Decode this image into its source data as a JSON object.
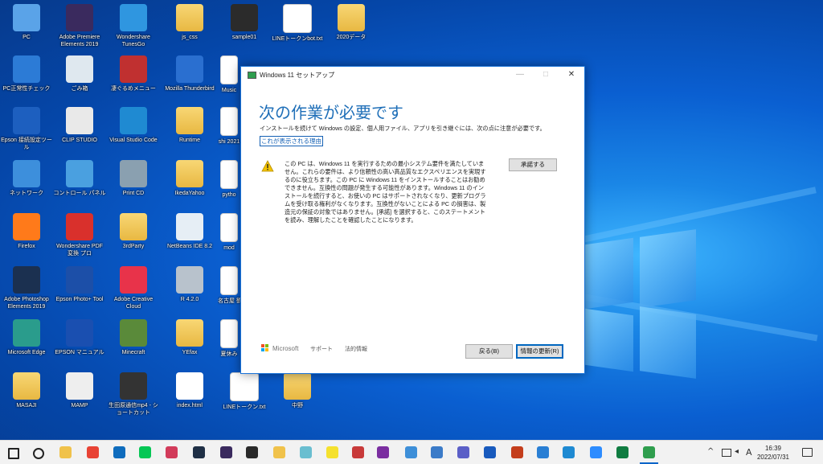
{
  "desktop": {
    "icons": [
      {
        "label": "PC",
        "icon": "pc-icon",
        "color": "#5aa3e8",
        "kind": "app"
      },
      {
        "label": "Adobe Premiere Elements 2019",
        "icon": "premiere-elements-icon",
        "color": "#3a2a5e",
        "kind": "app"
      },
      {
        "label": "Wondershare TunesGo",
        "icon": "tunesgo-icon",
        "color": "#2f96e0",
        "kind": "app"
      },
      {
        "label": "js_css",
        "icon": "folder-icon",
        "kind": "folder"
      },
      {
        "label": "sample01",
        "icon": "chrome-shortcut-icon",
        "color": "#2b2b2b",
        "kind": "app"
      },
      {
        "label": "LINEトークンbot.txt",
        "icon": "text-file-icon",
        "kind": "file"
      },
      {
        "label": "2020データ",
        "icon": "folder-icon",
        "kind": "folder"
      },
      {
        "label": "PC正常性チェック",
        "icon": "pc-health-check-icon",
        "color": "#2c7bd6",
        "kind": "app"
      },
      {
        "label": "ごみ箱",
        "icon": "recycle-bin-icon",
        "color": "#dfe8ef",
        "kind": "app"
      },
      {
        "label": "凄ぐるめメニュー",
        "icon": "menu-app-icon",
        "color": "#c03030",
        "kind": "app"
      },
      {
        "label": "Mozilla Thunderbird",
        "icon": "thunderbird-icon",
        "color": "#2a6fd0",
        "kind": "app"
      },
      {
        "label": "Epson 接続設定ツール",
        "icon": "epson-connect-icon",
        "color": "#1d5fbf",
        "kind": "app"
      },
      {
        "label": "CLIP STUDIO",
        "icon": "clip-studio-icon",
        "color": "#e9e9e9",
        "kind": "app"
      },
      {
        "label": "Visual Studio Code",
        "icon": "vscode-icon",
        "color": "#1f8ad2",
        "kind": "app"
      },
      {
        "label": "Runtime",
        "icon": "folder-icon",
        "kind": "folder"
      },
      {
        "label": "ネットワーク",
        "icon": "network-icon",
        "color": "#3d8fdc",
        "kind": "app"
      },
      {
        "label": "コントロール パネル",
        "icon": "control-panel-icon",
        "color": "#4aa0e0",
        "kind": "app"
      },
      {
        "label": "Print CD",
        "icon": "print-cd-icon",
        "color": "#8aa0b0",
        "kind": "app"
      },
      {
        "label": "IkedaYahoo",
        "icon": "folder-icon",
        "kind": "folder"
      },
      {
        "label": "Firefox",
        "icon": "firefox-icon",
        "color": "#ff7a1a",
        "kind": "app"
      },
      {
        "label": "Wondershare PDF 変換 プロ",
        "icon": "wondershare-pdf-icon",
        "color": "#d9302c",
        "kind": "app"
      },
      {
        "label": "3rdParty",
        "icon": "folder-icon",
        "kind": "folder"
      },
      {
        "label": "NetBeans IDE 8.2",
        "icon": "netbeans-icon",
        "color": "#e6eef5",
        "kind": "app"
      },
      {
        "label": "Adobe Photoshop Elements 2019",
        "icon": "photoshop-elements-icon",
        "color": "#1b3050",
        "kind": "app"
      },
      {
        "label": "Epson Photo+ Tool",
        "icon": "epson-photo-icon",
        "color": "#1c4fa8",
        "kind": "app"
      },
      {
        "label": "Adobe Creative Cloud",
        "icon": "creative-cloud-icon",
        "color": "#e8334a",
        "kind": "app"
      },
      {
        "label": "R 4.2.0",
        "icon": "r-language-icon",
        "color": "#b8c2cc",
        "kind": "app"
      },
      {
        "label": "Microsoft Edge",
        "icon": "edge-icon",
        "color": "#2a9c8c",
        "kind": "app"
      },
      {
        "label": "EPSON マニュアル",
        "icon": "epson-manual-icon",
        "color": "#1a4fb0",
        "kind": "app"
      },
      {
        "label": "Minecraft",
        "icon": "minecraft-icon",
        "color": "#5a8a3a",
        "kind": "app"
      },
      {
        "label": "YEfax",
        "icon": "folder-icon",
        "kind": "folder"
      },
      {
        "label": "MASAJI",
        "icon": "user-folder-icon",
        "kind": "folder"
      },
      {
        "label": "MAMP",
        "icon": "mamp-icon",
        "color": "#eeeeee",
        "kind": "app"
      },
      {
        "label": "生田原通信mp4 - ショートカット",
        "icon": "video-shortcut-icon",
        "color": "#333",
        "kind": "app"
      },
      {
        "label": "index.html",
        "icon": "chrome-html-icon",
        "color": "#ffffff",
        "kind": "app"
      },
      {
        "label": "LINEトークン.txt",
        "icon": "text-file-icon",
        "kind": "file"
      },
      {
        "label": "中野",
        "icon": "folder-icon",
        "kind": "folder"
      }
    ],
    "partial_icons": [
      {
        "label": "Music",
        "icon": "music-icon"
      },
      {
        "label": "shi 2021",
        "icon": "file-icon"
      },
      {
        "label": "pytho",
        "icon": "folder-icon"
      },
      {
        "label": "mod",
        "icon": "file-icon"
      },
      {
        "label": "名古屋 鶴2",
        "icon": "excel-file-icon"
      },
      {
        "label": "夏休み",
        "icon": "file-icon"
      }
    ]
  },
  "dialog": {
    "title": "Windows 11 セットアップ",
    "minimize": "—",
    "maximize": "□",
    "close": "✕",
    "heading": "次の作業が必要です",
    "subtext": "インストールを続けて Windows の設定、個人用ファイル、アプリを引き継ぐには、次の点に注意が必要です。",
    "reason_link": "これが表示される理由",
    "warning_text": "この PC は、Windows 11 を実行するための最小システム要件を満たしていません。これらの要件は、より信頼性の高い高品質なエクスペリエンスを実現するのに役立ちます。この PC に Windows 11 をインストールすることはお勧めできません。互換性の問題が発生する可能性があります。Windows 11 のインストールを続行すると、お使いの PC はサポートされなくなり、更新プログラムを受け取る権利がなくなります。互換性がないことによる PC の損害は、製造元の保証の対象ではありません。[承諾] を選択すると、このステートメントを読み、理解したことを確認したことになります。",
    "accept_button": "承諾する",
    "microsoft": "Microsoft",
    "support_link": "サポート",
    "legal_link": "法的情報",
    "back_button": "戻る(B)",
    "refresh_button": "情報の更新(R)"
  },
  "taskbar": {
    "apps": [
      {
        "icon": "start-icon",
        "color": "#222222"
      },
      {
        "icon": "search-icon",
        "color": "#222222"
      },
      {
        "icon": "file-explorer-icon",
        "color": "#f0c24b"
      },
      {
        "icon": "chrome-icon",
        "color": "#e84335"
      },
      {
        "icon": "outlook-icon",
        "color": "#0f6cbd"
      },
      {
        "icon": "line-icon",
        "color": "#06c755"
      },
      {
        "icon": "paint-icon",
        "color": "#d23b5a"
      },
      {
        "icon": "photo-app-icon",
        "color": "#1f2f45"
      },
      {
        "icon": "premiere-icon",
        "color": "#3a2a5e"
      },
      {
        "icon": "media-icon",
        "color": "#2a2a2a"
      },
      {
        "icon": "folder-icon",
        "color": "#f0c24b"
      },
      {
        "icon": "nullsoft-icon",
        "color": "#6abed0"
      },
      {
        "icon": "sticky-note-icon",
        "color": "#f5e12e"
      },
      {
        "icon": "pdf-icon",
        "color": "#c83a3a"
      },
      {
        "icon": "onenote-icon",
        "color": "#7b2ea0"
      },
      {
        "icon": "teams-chat-icon",
        "color": "#3e8fd8"
      },
      {
        "icon": "database-icon",
        "color": "#3b7bc8"
      },
      {
        "icon": "teams-icon",
        "color": "#5b5fc7"
      },
      {
        "icon": "word-icon",
        "color": "#185abd"
      },
      {
        "icon": "powerpoint-icon",
        "color": "#c43e1c"
      },
      {
        "icon": "movie-icon",
        "color": "#2a7fd4"
      },
      {
        "icon": "vscode-icon",
        "color": "#1f8ad2"
      },
      {
        "icon": "zoom-icon",
        "color": "#2d8cff"
      },
      {
        "icon": "excel-icon",
        "color": "#107c41"
      },
      {
        "icon": "setup-icon",
        "color": "#2f9e4e"
      }
    ],
    "tray": {
      "chevron": "^",
      "ime": "A",
      "time": "16:39",
      "date": "2022/07/31"
    }
  }
}
